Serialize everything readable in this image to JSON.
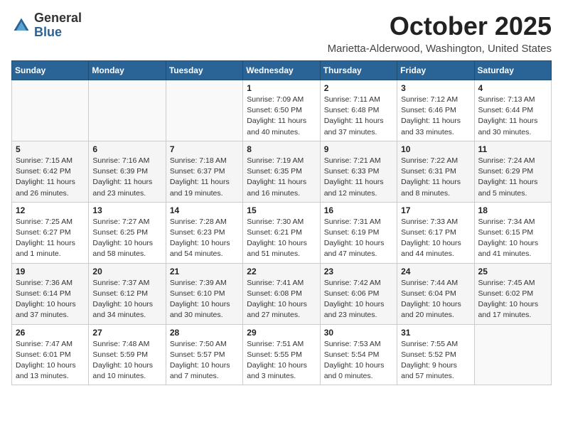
{
  "logo": {
    "general": "General",
    "blue": "Blue"
  },
  "header": {
    "month": "October 2025",
    "location": "Marietta-Alderwood, Washington, United States"
  },
  "weekdays": [
    "Sunday",
    "Monday",
    "Tuesday",
    "Wednesday",
    "Thursday",
    "Friday",
    "Saturday"
  ],
  "weeks": [
    [
      {
        "day": "",
        "info": ""
      },
      {
        "day": "",
        "info": ""
      },
      {
        "day": "",
        "info": ""
      },
      {
        "day": "1",
        "info": "Sunrise: 7:09 AM\nSunset: 6:50 PM\nDaylight: 11 hours and 40 minutes."
      },
      {
        "day": "2",
        "info": "Sunrise: 7:11 AM\nSunset: 6:48 PM\nDaylight: 11 hours and 37 minutes."
      },
      {
        "day": "3",
        "info": "Sunrise: 7:12 AM\nSunset: 6:46 PM\nDaylight: 11 hours and 33 minutes."
      },
      {
        "day": "4",
        "info": "Sunrise: 7:13 AM\nSunset: 6:44 PM\nDaylight: 11 hours and 30 minutes."
      }
    ],
    [
      {
        "day": "5",
        "info": "Sunrise: 7:15 AM\nSunset: 6:42 PM\nDaylight: 11 hours and 26 minutes."
      },
      {
        "day": "6",
        "info": "Sunrise: 7:16 AM\nSunset: 6:39 PM\nDaylight: 11 hours and 23 minutes."
      },
      {
        "day": "7",
        "info": "Sunrise: 7:18 AM\nSunset: 6:37 PM\nDaylight: 11 hours and 19 minutes."
      },
      {
        "day": "8",
        "info": "Sunrise: 7:19 AM\nSunset: 6:35 PM\nDaylight: 11 hours and 16 minutes."
      },
      {
        "day": "9",
        "info": "Sunrise: 7:21 AM\nSunset: 6:33 PM\nDaylight: 11 hours and 12 minutes."
      },
      {
        "day": "10",
        "info": "Sunrise: 7:22 AM\nSunset: 6:31 PM\nDaylight: 11 hours and 8 minutes."
      },
      {
        "day": "11",
        "info": "Sunrise: 7:24 AM\nSunset: 6:29 PM\nDaylight: 11 hours and 5 minutes."
      }
    ],
    [
      {
        "day": "12",
        "info": "Sunrise: 7:25 AM\nSunset: 6:27 PM\nDaylight: 11 hours and 1 minute."
      },
      {
        "day": "13",
        "info": "Sunrise: 7:27 AM\nSunset: 6:25 PM\nDaylight: 10 hours and 58 minutes."
      },
      {
        "day": "14",
        "info": "Sunrise: 7:28 AM\nSunset: 6:23 PM\nDaylight: 10 hours and 54 minutes."
      },
      {
        "day": "15",
        "info": "Sunrise: 7:30 AM\nSunset: 6:21 PM\nDaylight: 10 hours and 51 minutes."
      },
      {
        "day": "16",
        "info": "Sunrise: 7:31 AM\nSunset: 6:19 PM\nDaylight: 10 hours and 47 minutes."
      },
      {
        "day": "17",
        "info": "Sunrise: 7:33 AM\nSunset: 6:17 PM\nDaylight: 10 hours and 44 minutes."
      },
      {
        "day": "18",
        "info": "Sunrise: 7:34 AM\nSunset: 6:15 PM\nDaylight: 10 hours and 41 minutes."
      }
    ],
    [
      {
        "day": "19",
        "info": "Sunrise: 7:36 AM\nSunset: 6:14 PM\nDaylight: 10 hours and 37 minutes."
      },
      {
        "day": "20",
        "info": "Sunrise: 7:37 AM\nSunset: 6:12 PM\nDaylight: 10 hours and 34 minutes."
      },
      {
        "day": "21",
        "info": "Sunrise: 7:39 AM\nSunset: 6:10 PM\nDaylight: 10 hours and 30 minutes."
      },
      {
        "day": "22",
        "info": "Sunrise: 7:41 AM\nSunset: 6:08 PM\nDaylight: 10 hours and 27 minutes."
      },
      {
        "day": "23",
        "info": "Sunrise: 7:42 AM\nSunset: 6:06 PM\nDaylight: 10 hours and 23 minutes."
      },
      {
        "day": "24",
        "info": "Sunrise: 7:44 AM\nSunset: 6:04 PM\nDaylight: 10 hours and 20 minutes."
      },
      {
        "day": "25",
        "info": "Sunrise: 7:45 AM\nSunset: 6:02 PM\nDaylight: 10 hours and 17 minutes."
      }
    ],
    [
      {
        "day": "26",
        "info": "Sunrise: 7:47 AM\nSunset: 6:01 PM\nDaylight: 10 hours and 13 minutes."
      },
      {
        "day": "27",
        "info": "Sunrise: 7:48 AM\nSunset: 5:59 PM\nDaylight: 10 hours and 10 minutes."
      },
      {
        "day": "28",
        "info": "Sunrise: 7:50 AM\nSunset: 5:57 PM\nDaylight: 10 hours and 7 minutes."
      },
      {
        "day": "29",
        "info": "Sunrise: 7:51 AM\nSunset: 5:55 PM\nDaylight: 10 hours and 3 minutes."
      },
      {
        "day": "30",
        "info": "Sunrise: 7:53 AM\nSunset: 5:54 PM\nDaylight: 10 hours and 0 minutes."
      },
      {
        "day": "31",
        "info": "Sunrise: 7:55 AM\nSunset: 5:52 PM\nDaylight: 9 hours and 57 minutes."
      },
      {
        "day": "",
        "info": ""
      }
    ]
  ]
}
